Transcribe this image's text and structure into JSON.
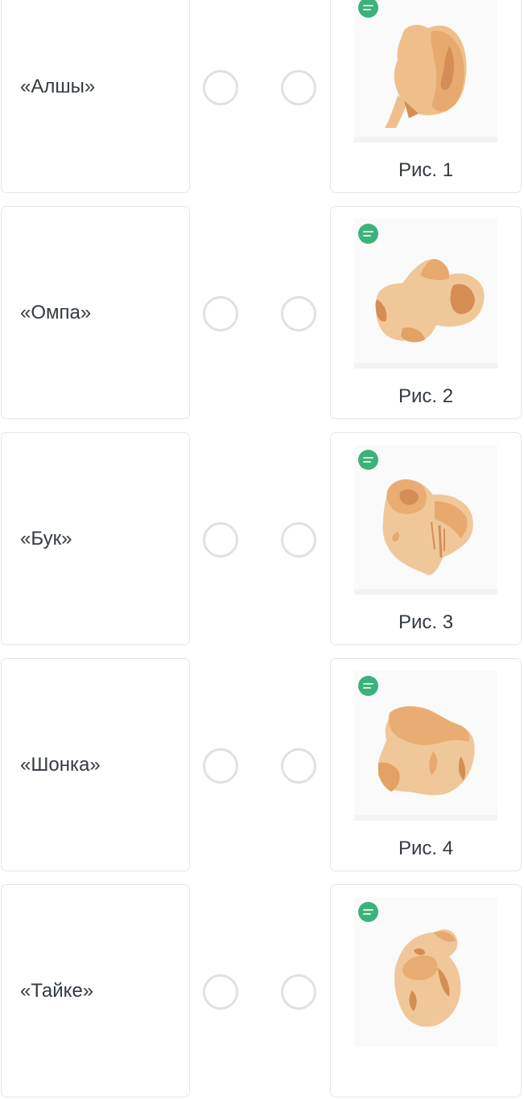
{
  "items": [
    {
      "word": "«Алшы»",
      "caption": "Рис. 1"
    },
    {
      "word": "«Омпа»",
      "caption": "Рис. 2"
    },
    {
      "word": "«Бук»",
      "caption": "Рис. 3"
    },
    {
      "word": "«Шонка»",
      "caption": "Рис. 4"
    },
    {
      "word": "«Тайке»",
      "caption": ""
    }
  ],
  "colors": {
    "bone_light": "#f0c799",
    "bone_mid": "#e9ad73",
    "bone_dark": "#d48e55",
    "badge": "#3bb27a",
    "border": "#e3e6ea",
    "text": "#333a42"
  },
  "icons": {
    "badge": "site-logo-badge",
    "image": "asyk-bone-illustration"
  }
}
